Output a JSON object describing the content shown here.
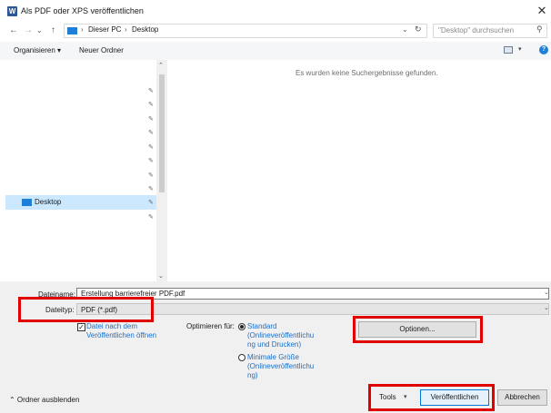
{
  "window": {
    "app_icon": "W",
    "title": "Als PDF oder XPS veröffentlichen",
    "close_glyph": "✕"
  },
  "navigation": {
    "back_glyph": "←",
    "forward_glyph": "→",
    "recent_glyph": "⌄",
    "up_glyph": "↑",
    "crumb_separator": "›",
    "breadcrumbs": [
      "Dieser PC",
      "Desktop"
    ],
    "dropdown_glyph": "⌄",
    "refresh_glyph": "↻",
    "search_placeholder": "\"Desktop\" durchsuchen",
    "search_glyph": "⚲"
  },
  "toolbar": {
    "organize_label": "Organisieren ▾",
    "new_folder_label": "Neuer Ordner",
    "view_dropdown_glyph": "▾",
    "help_glyph": "?"
  },
  "nav_pane": {
    "pin_glyph": "✎",
    "selected_item": "Desktop",
    "scroll_up_glyph": "⌃",
    "scroll_down_glyph": "⌄"
  },
  "content": {
    "empty_message": "Es wurden keine Suchergebnisse gefunden."
  },
  "form": {
    "filename_label": "Dateiname:",
    "filename_value": "Erstellung barrierefreier PDF.pdf",
    "filetype_label": "Dateityp:",
    "filetype_value": "PDF (*.pdf)",
    "dropdown_glyph": "⌄",
    "open_after_publish_checked": true,
    "open_after_publish_lines": [
      "Datei nach dem",
      "Veröffentlichen öffnen"
    ],
    "optimize_label": "Optimieren für:",
    "standard_lines": [
      "Standard",
      "(Onlineveröffentlichu",
      "ng und Drucken)"
    ],
    "standard_selected": true,
    "minimal_lines": [
      "Minimale Größe",
      "(Onlineveröffentlichu",
      "ng)"
    ],
    "options_button": "Optionen..."
  },
  "footer": {
    "hide_folders_label": "⌃  Ordner ausblenden",
    "tools_label": "Tools",
    "tools_dropdown_glyph": "▾",
    "publish_button": "Veröffentlichen",
    "cancel_button": "Abbrechen"
  },
  "colors": {
    "highlight": "#e00000",
    "accent": "#0078d7",
    "selection": "#cce8ff",
    "link": "#1a6fc9"
  }
}
